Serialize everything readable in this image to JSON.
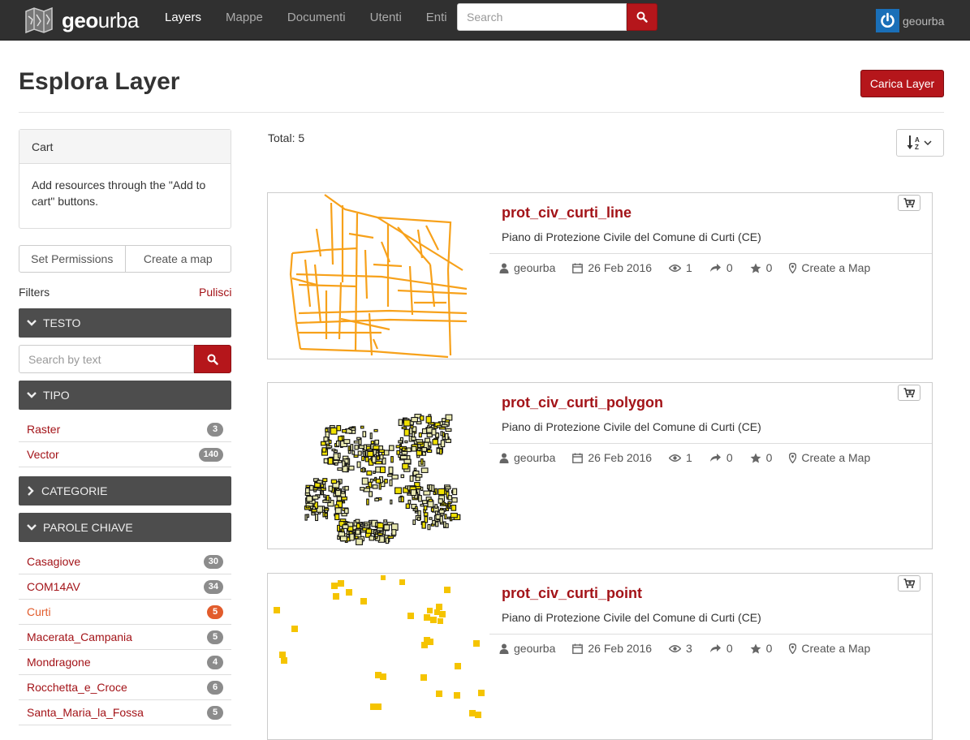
{
  "brand": {
    "name_bold": "geo",
    "name_rest": "urba"
  },
  "nav": {
    "items": [
      "Layers",
      "Mappe",
      "Documenti",
      "Utenti",
      "Enti"
    ]
  },
  "search": {
    "placeholder": "Search"
  },
  "user": {
    "name": "geourba"
  },
  "page": {
    "title": "Esplora Layer",
    "upload_label": "Carica Layer"
  },
  "cart": {
    "title": "Cart",
    "message": "Add resources through the \"Add to cart\" buttons."
  },
  "actions": {
    "set_permissions": "Set Permissions",
    "create_map": "Create a map"
  },
  "filters": {
    "label": "Filters",
    "clear": "Pulisci",
    "text_facet": "TESTO",
    "text_placeholder": "Search by text",
    "type_facet": "TIPO",
    "types": [
      {
        "label": "Raster",
        "count": "3"
      },
      {
        "label": "Vector",
        "count": "140"
      }
    ],
    "categories_facet": "CATEGORIE",
    "keywords_facet": "PAROLE CHIAVE",
    "keywords": [
      {
        "label": "Casagiove",
        "count": "30"
      },
      {
        "label": "COM14AV",
        "count": "34"
      },
      {
        "label": "Curti",
        "count": "5"
      },
      {
        "label": "Macerata_Campania",
        "count": "5"
      },
      {
        "label": "Mondragone",
        "count": "4"
      },
      {
        "label": "Rocchetta_e_Croce",
        "count": "6"
      },
      {
        "label": "Santa_Maria_la_Fossa",
        "count": "5"
      }
    ]
  },
  "results": {
    "total": "Total: 5",
    "layers": [
      {
        "title": "prot_civ_curti_line",
        "abstract": "Piano di Protezione Civile del Comune di Curti (CE)",
        "owner": "geourba",
        "date": "26 Feb 2016",
        "views": "1",
        "shares": "0",
        "rating": "0",
        "create_map": "Create a Map"
      },
      {
        "title": "prot_civ_curti_polygon",
        "abstract": "Piano di Protezione Civile del Comune di Curti (CE)",
        "owner": "geourba",
        "date": "26 Feb 2016",
        "views": "1",
        "shares": "0",
        "rating": "0",
        "create_map": "Create a Map"
      },
      {
        "title": "prot_civ_curti_point",
        "abstract": "Piano di Protezione Civile del Comune di Curti (CE)",
        "owner": "geourba",
        "date": "26 Feb 2016",
        "views": "3",
        "shares": "0",
        "rating": "0",
        "create_map": "Create a Map"
      }
    ]
  },
  "colors": {
    "accent": "#b5161b",
    "link": "#a31318",
    "nav_bg": "#303030",
    "facet_bg": "#4d4d4d",
    "highlight": "#e25c2c"
  }
}
